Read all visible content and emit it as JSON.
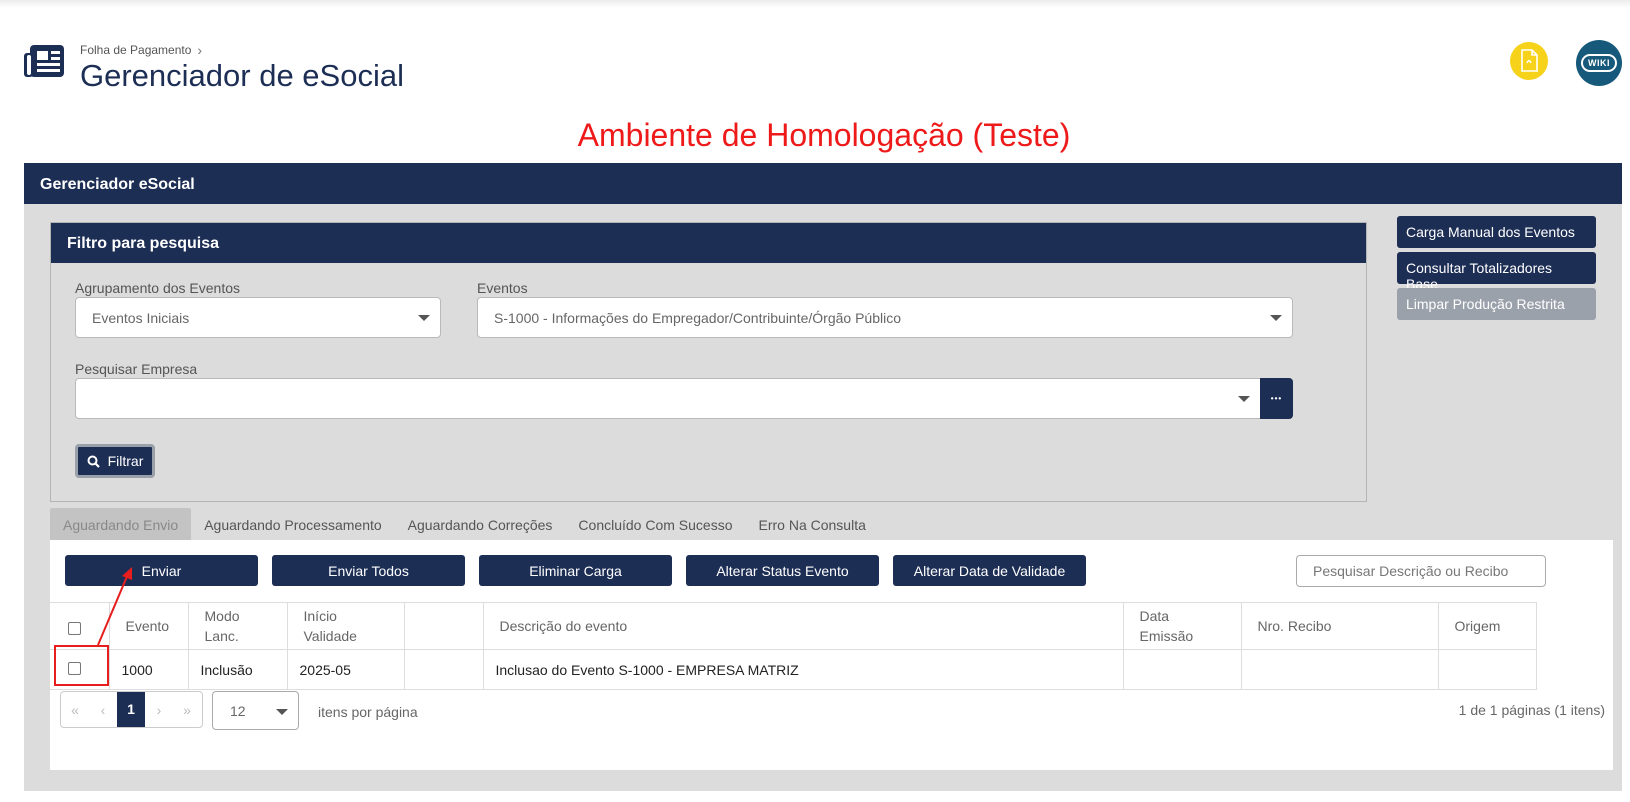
{
  "header": {
    "breadcrumb": "Folha de Pagamento",
    "breadcrumb_sep": "›",
    "title": "Gerenciador de eSocial",
    "wiki_label": "WIKI"
  },
  "banner": "Ambiente de Homologação (Teste)",
  "panel": {
    "title": "Gerenciador eSocial"
  },
  "filter": {
    "title": "Filtro para pesquisa",
    "group_label": "Agrupamento dos Eventos",
    "group_value": "Eventos Iniciais",
    "events_label": "Eventos",
    "events_value": "S-1000 - Informações do Empregador/Contribuinte/Órgão Público",
    "company_label": "Pesquisar Empresa",
    "company_value": "",
    "dots": "•••",
    "filter_button": "Filtrar"
  },
  "side_actions": {
    "manual_load": "Carga Manual dos Eventos",
    "totals": "Consultar Totalizadores Base",
    "clear": "Limpar Produção Restrita"
  },
  "tabs": [
    "Aguardando Envio",
    "Aguardando Processamento",
    "Aguardando Correções",
    "Concluído Com Sucesso",
    "Erro Na Consulta"
  ],
  "actions": {
    "send": "Enviar",
    "send_all": "Enviar Todos",
    "delete_load": "Eliminar Carga",
    "change_status": "Alterar Status Evento",
    "change_date": "Alterar Data de Validade"
  },
  "search": {
    "placeholder": "Pesquisar Descrição ou Recibo"
  },
  "table": {
    "columns": [
      "Evento",
      "Modo Lanc.",
      "Início Validade",
      "",
      "Descrição do evento",
      "Data Emissão",
      "Nro. Recibo",
      "Origem"
    ],
    "rows": [
      {
        "evento": "1000",
        "modo": "Inclusão",
        "inicio": "2025-05",
        "extra": "",
        "descricao": "Inclusao do Evento S-1000 - EMPRESA MATRIZ",
        "data": "",
        "recibo": "",
        "origem": ""
      }
    ]
  },
  "pager": {
    "first": "«",
    "prev": "‹",
    "current": "1",
    "next": "›",
    "last": "»",
    "page_size": "12",
    "per_page_label": "itens por página",
    "info": "1 de 1 páginas (1 itens)"
  },
  "colors": {
    "navy": "#1d2e55",
    "banner_red": "#ee1a1a",
    "highlight_red": "#e61e1e",
    "yellow": "#f6d21b",
    "wiki_teal": "#16597a"
  }
}
